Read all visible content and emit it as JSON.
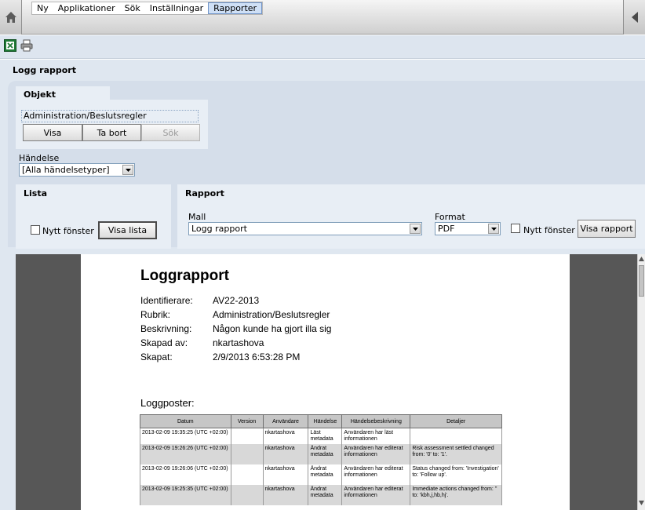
{
  "menu": {
    "items": [
      "Ny",
      "Applikationer",
      "Sök",
      "Inställningar",
      "Rapporter"
    ],
    "active_index": 4
  },
  "icons": {
    "home": "home-icon",
    "back": "back-arrow-icon",
    "excel": "excel-export-icon",
    "print": "print-icon"
  },
  "page": {
    "title": "Logg rapport"
  },
  "objekt": {
    "title": "Objekt",
    "path": "Administration/Beslutsregler",
    "buttons": {
      "visa": "Visa",
      "ta_bort": "Ta bort",
      "sok": "Sök"
    }
  },
  "handelse": {
    "label": "Händelse",
    "value": "[Alla händelsetyper]"
  },
  "lista": {
    "title": "Lista",
    "checkbox_label": "Nytt fönster",
    "button": "Visa lista"
  },
  "rapport": {
    "title": "Rapport",
    "mall_label": "Mall",
    "mall_value": "Logg rapport",
    "format_label": "Format",
    "format_value": "PDF",
    "checkbox_label": "Nytt fönster",
    "button": "Visa rapport"
  },
  "report": {
    "title": "Loggrapport",
    "fields": [
      {
        "key": "Identifierare:",
        "value": "AV22-2013"
      },
      {
        "key": "Rubrik:",
        "value": "Administration/Beslutsregler"
      },
      {
        "key": "Beskrivning:",
        "value": "Någon kunde ha gjort illa sig"
      },
      {
        "key": "Skapad av:",
        "value": "nkartashova"
      },
      {
        "key": "Skapat:",
        "value": "2/9/2013 6:53:28 PM"
      }
    ],
    "posts_label": "Loggposter:",
    "columns": [
      "Datum",
      "Version",
      "Användare",
      "Händelse",
      "Händelsebeskrivning",
      "Detaljer"
    ],
    "rows": [
      [
        "2013-02-09 19:35:25 (UTC +02:00)",
        "",
        "nkartashova",
        "Läst metadata",
        "Användaren har läst informationen",
        ""
      ],
      [
        "2013-02-09 19:26:26 (UTC +02:00)",
        "",
        "nkartashova",
        "Ändrat metadata",
        "Användaren har editerat informationen",
        "Risk assessment settled changed from: '0' to: '1'."
      ],
      [
        "2013-02-09 19:26:06 (UTC +02:00)",
        "",
        "nkartashova",
        "Ändrat metadata",
        "Användaren har editerat informationen",
        "Status changed from: 'Investigation' to: 'Follow up'."
      ],
      [
        "2013-02-09 19:25:35 (UTC +02:00)",
        "",
        "nkartashova",
        "Ändrat metadata",
        "Användaren har editerat informationen",
        "Immediate actions changed from: '' to: 'kbh,j,hb,hj'."
      ]
    ]
  }
}
